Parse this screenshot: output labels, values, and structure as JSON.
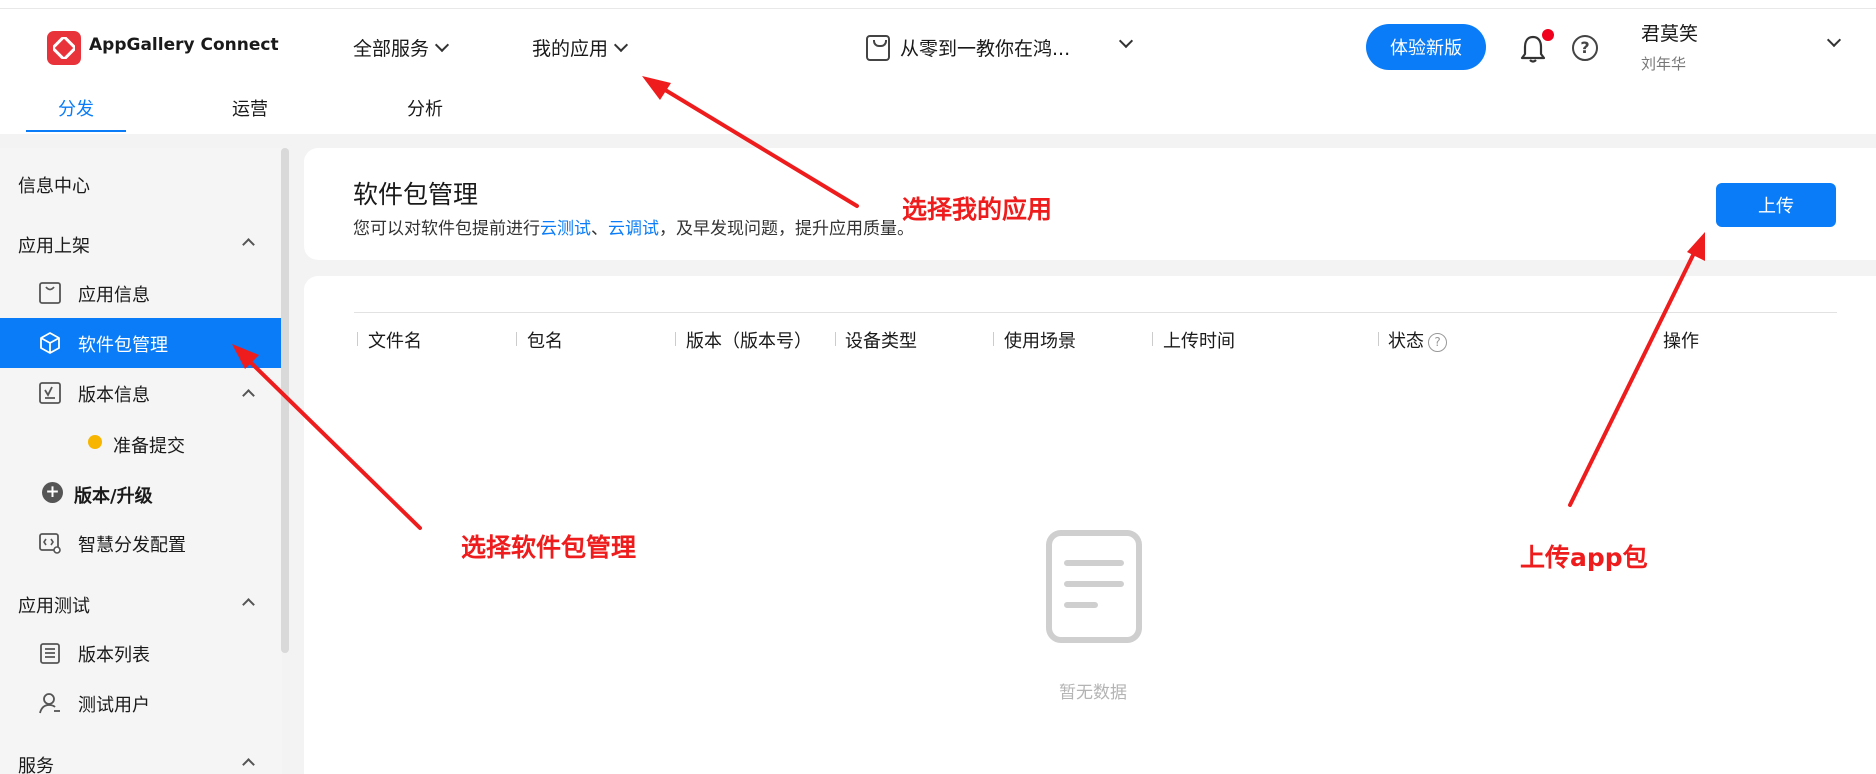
{
  "header": {
    "brand": "AppGallery Connect",
    "all_services": "全部服务",
    "my_apps": "我的应用",
    "current_app": "从零到一教你在鸿...",
    "try_new": "体验新版",
    "user_name": "君莫笑",
    "user_sub": "刘年华"
  },
  "tabs": [
    "分发",
    "运营",
    "分析"
  ],
  "sidebar": {
    "info_center": "信息中心",
    "group_release": "应用上架",
    "app_info": "应用信息",
    "package_mgmt": "软件包管理",
    "version_info": "版本信息",
    "ready_submit": "准备提交",
    "version_upgrade": "版本/升级",
    "smart_distribution": "智慧分发配置",
    "group_test": "应用测试",
    "version_list": "版本列表",
    "test_users": "测试用户",
    "group_service": "服务"
  },
  "main": {
    "title": "软件包管理",
    "desc_prefix": "您可以对软件包提前进行",
    "desc_link1": "云测试",
    "desc_sep": "、",
    "desc_link2": "云调试",
    "desc_suffix": "，及早发现问题，提升应用质量。",
    "upload": "上传",
    "columns": [
      "文件名",
      "包名",
      "版本（版本号）",
      "设备类型",
      "使用场景",
      "上传时间",
      "状态",
      "操作"
    ],
    "empty": "暂无数据"
  },
  "annotations": {
    "choose_my_app": "选择我的应用",
    "choose_package": "选择软件包管理",
    "upload_app": "上传app包"
  },
  "colors": {
    "accent": "#0a7cf7",
    "annotation": "#ee1c1c",
    "brand": "#e8333b",
    "badge": "#f0001c",
    "status_dot": "#f7b500"
  }
}
